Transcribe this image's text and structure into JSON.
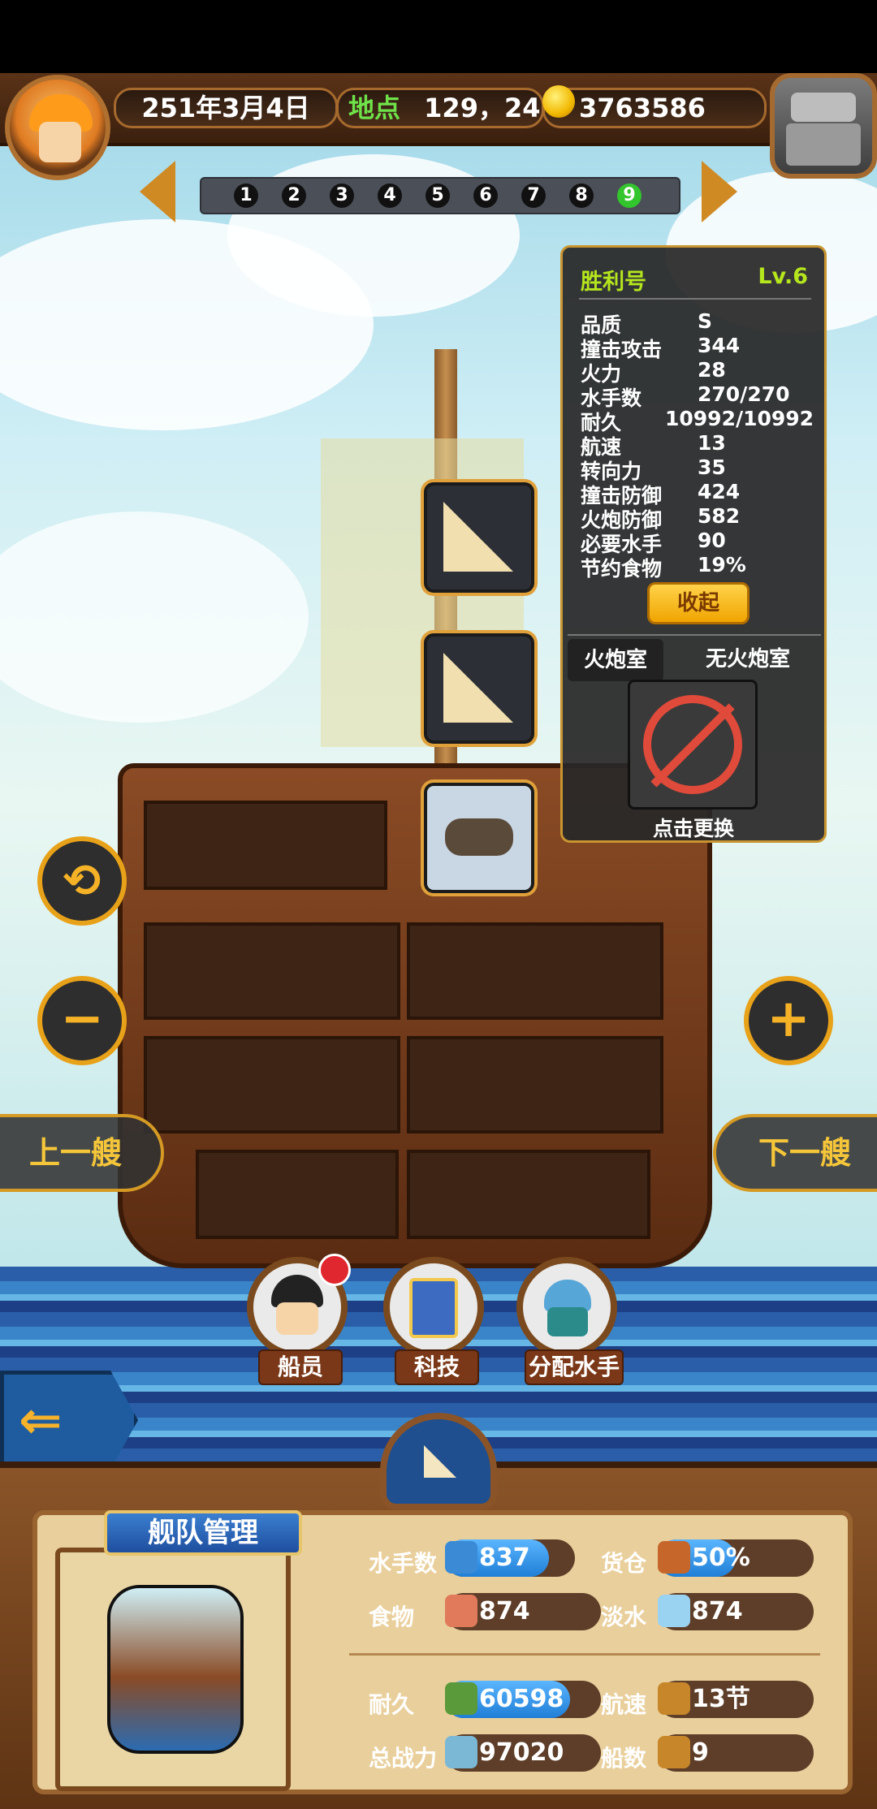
{
  "header": {
    "date": "251年3月4日",
    "location_label": "地点",
    "location_value": "129，24",
    "gold": "3763586"
  },
  "pages": [
    "1",
    "2",
    "3",
    "4",
    "5",
    "6",
    "7",
    "8",
    "9"
  ],
  "active_page": "9",
  "ship_info": {
    "name": "胜利号",
    "level": "Lv.6",
    "stats": [
      {
        "label": "品质",
        "value": "S"
      },
      {
        "label": "撞击攻击",
        "value": "344"
      },
      {
        "label": "火力",
        "value": "28"
      },
      {
        "label": "水手数",
        "value": "270/270"
      },
      {
        "label": "耐久",
        "value": "10992/10992"
      },
      {
        "label": "航速",
        "value": "13"
      },
      {
        "label": "转向力",
        "value": "35"
      },
      {
        "label": "撞击防御",
        "value": "424"
      },
      {
        "label": "火炮防御",
        "value": "582"
      },
      {
        "label": "必要水手",
        "value": "90"
      },
      {
        "label": "节约食物",
        "value": "19%"
      }
    ],
    "collapse_label": "收起",
    "cannon_room_label": "火炮室",
    "no_cannon_label": "无火炮室",
    "replace_label": "点击更换"
  },
  "ship_nav": {
    "prev_label": "上一艘",
    "next_label": "下一艘"
  },
  "menu": {
    "crew_label": "船员",
    "tech_label": "科技",
    "assign_label": "分配水手"
  },
  "fleet": {
    "title": "舰队管理",
    "rows": [
      {
        "label": "水手数",
        "value": "837",
        "fill": 0.8,
        "icon_color": "#3a8ad6"
      },
      {
        "label": "货仓",
        "value": "50%",
        "fill": 0.5,
        "icon_color": "#c7662a"
      },
      {
        "label": "食物",
        "value": "874",
        "fill": 0.0,
        "icon_color": "#e07a5a"
      },
      {
        "label": "淡水",
        "value": "874",
        "fill": 0.0,
        "icon_color": "#9ad2f2"
      },
      {
        "label": "耐久",
        "value": "60598",
        "fill": 0.8,
        "icon_color": "#5a9a3a"
      },
      {
        "label": "航速",
        "value": "13节",
        "fill": 0.0,
        "icon_color": "#c7862a"
      },
      {
        "label": "总战力",
        "value": "97020",
        "fill": 0.0,
        "icon_color": "#7ab8d6"
      },
      {
        "label": "船数",
        "value": "9",
        "fill": 0.0,
        "icon_color": "#c7862a"
      }
    ]
  },
  "colors": {
    "accent_gold": "#e8a21a",
    "location_green": "#6fe24a",
    "level_green": "#b5e61d",
    "page_active": "#33c52d"
  }
}
